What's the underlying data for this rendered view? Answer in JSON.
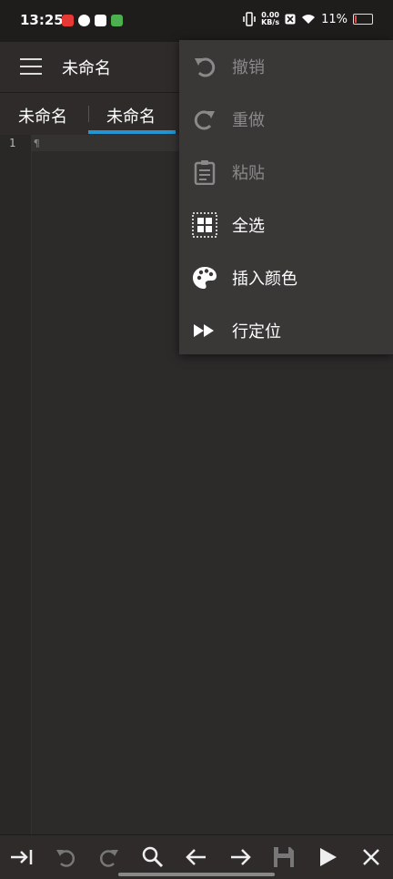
{
  "status_bar": {
    "time": "13:25",
    "net_speed_value": "0.00",
    "net_speed_unit": "KB/s",
    "battery_text": "11%",
    "battery_level": 0.11
  },
  "app_bar": {
    "title": "未命名"
  },
  "tabs": [
    {
      "label": "未命名",
      "active": false
    },
    {
      "label": "未命名",
      "active": true
    }
  ],
  "editor": {
    "line_numbers": [
      "1"
    ],
    "cursor_glyph": "¶"
  },
  "popup_menu": {
    "items": [
      {
        "label": "撤销",
        "icon": "undo-icon",
        "enabled": false
      },
      {
        "label": "重做",
        "icon": "redo-icon",
        "enabled": false
      },
      {
        "label": "粘贴",
        "icon": "clipboard-icon",
        "enabled": false
      },
      {
        "label": "全选",
        "icon": "select-all-icon",
        "enabled": true
      },
      {
        "label": "插入颜色",
        "icon": "palette-icon",
        "enabled": true
      },
      {
        "label": "行定位",
        "icon": "fast-forward-icon",
        "enabled": true
      }
    ]
  },
  "colors": {
    "accent": "#2196d3",
    "background": "#2d2a2a",
    "menu_background": "#3a3737",
    "disabled_text": "#8a8888"
  }
}
